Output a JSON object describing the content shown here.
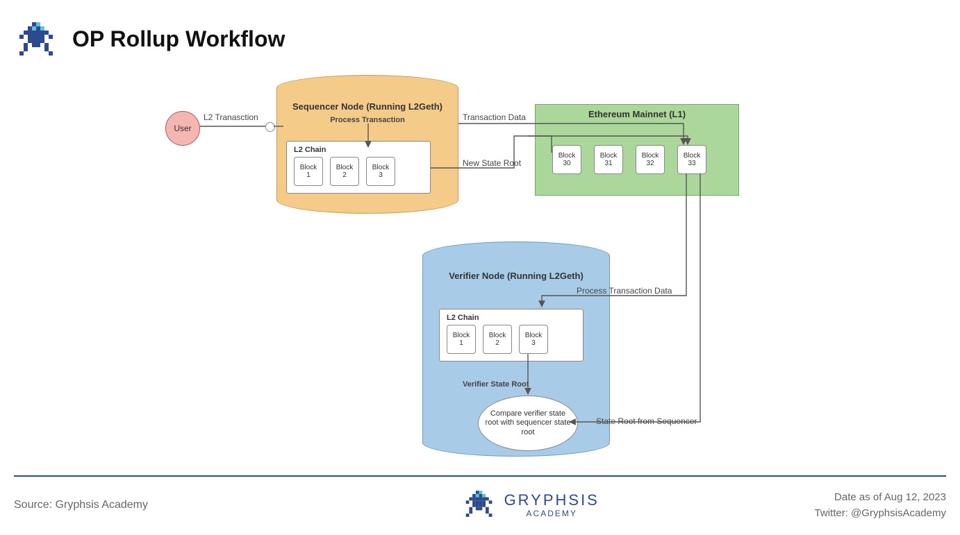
{
  "title": "OP Rollup Workflow",
  "footer": {
    "source": "Source: Gryphsis Academy",
    "brand_name": "GRYPHSIS",
    "brand_sub": "ACADEMY",
    "date": "Date as of Aug 12, 2023",
    "twitter": "Twitter: @GryphsisAcademy"
  },
  "diagram": {
    "user": "User",
    "edge_l2_tx": "L2 Tranasction",
    "sequencer_title": "Sequencer Node (Running L2Geth)",
    "process_tx": "Process Transaction",
    "l2chain_label": "L2 Chain",
    "blocks_l2": [
      "Block 1",
      "Block 2",
      "Block 3"
    ],
    "tx_data": "Transaction Data",
    "new_state_root": "New State Root",
    "l1_title": "Ethereum Mainnet (L1)",
    "blocks_l1": [
      "Block 30",
      "Block 31",
      "Block 32",
      "Block 33"
    ],
    "verifier_title": "Verifier Node (Running L2Geth)",
    "process_tx_data": "Process Transaction Data",
    "verifier_state_root": "Verifier State Root",
    "compare": "Compare verifier state root with sequencer state root",
    "state_root_from_seq": "State Root from Sequencer"
  }
}
